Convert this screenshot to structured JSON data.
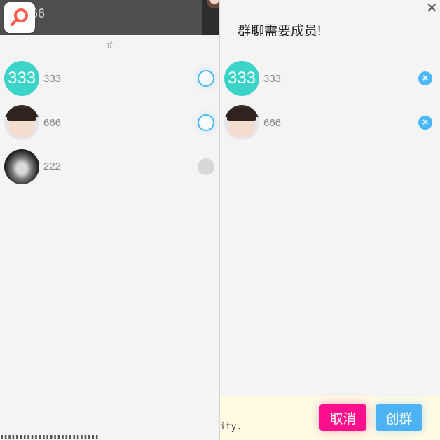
{
  "left_panel": {
    "search_peek_text": "66",
    "index_letter": "#",
    "contacts": [
      {
        "name": "333",
        "avatar_text": "333",
        "avatar_type": "teal-initials",
        "selected_state": "selectable"
      },
      {
        "name": "666",
        "avatar_type": "photo-girl",
        "selected_state": "selectable"
      },
      {
        "name": "222",
        "avatar_type": "photo-clouds",
        "selected_state": "disabled"
      }
    ],
    "logo_icon": "search-magnifier-icon"
  },
  "dialog": {
    "title": "群聊需要成员!",
    "close_label": "✕",
    "members": [
      {
        "name": "333",
        "avatar_text": "333",
        "avatar_type": "teal-initials"
      },
      {
        "name": "666",
        "avatar_type": "photo-girl"
      }
    ],
    "remove_label": "×",
    "footer_code_hint": "ity.",
    "cancel_label": "取消",
    "create_label": "创群"
  },
  "colors": {
    "accent_blue": "#4db8f7",
    "cancel_pink": "#ff0f8b",
    "teal_avatar": "#3cd3c9",
    "panel_bg": "#f4f4f4",
    "footer_bg": "#fffbe3"
  }
}
